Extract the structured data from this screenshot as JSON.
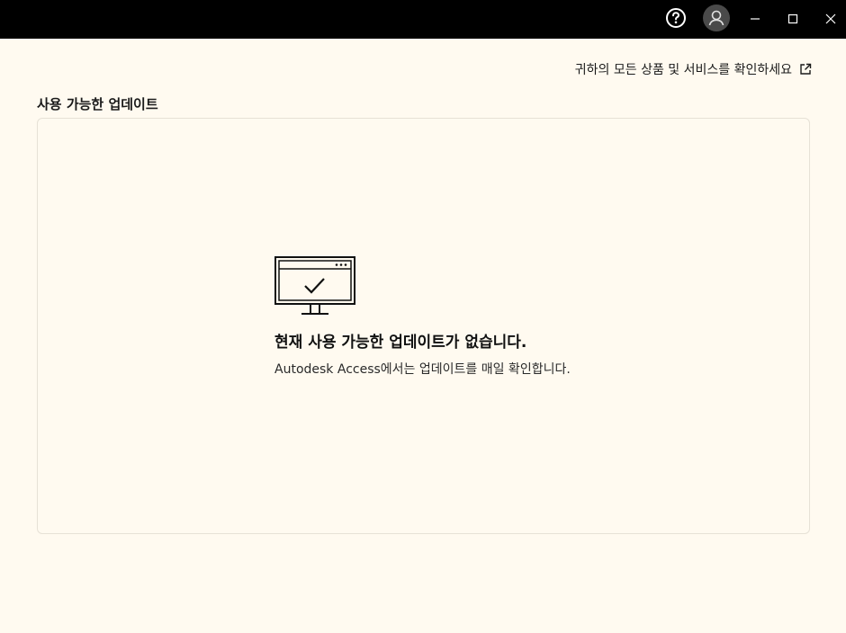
{
  "titlebar": {
    "help_icon": "question-circle-icon",
    "avatar_icon": "user-avatar-icon",
    "minimize_icon": "minimize-icon",
    "maximize_icon": "maximize-icon",
    "close_icon": "close-icon"
  },
  "header": {
    "all_products_link": "귀하의 모든 상품 및 서비스를 확인하세요",
    "external_icon": "external-link-icon"
  },
  "updates": {
    "section_title": "사용 가능한 업데이트",
    "empty": {
      "illustration": "monitor-check-icon",
      "title": "현재 사용 가능한 업데이트가 없습니다.",
      "description": "Autodesk Access에서는 업데이트를 매일 확인합니다."
    }
  },
  "colors": {
    "titlebar_bg": "#000000",
    "page_bg": "#fffaf0",
    "panel_border": "#e6e1d6",
    "avatar_bg": "#4a4a4a"
  }
}
